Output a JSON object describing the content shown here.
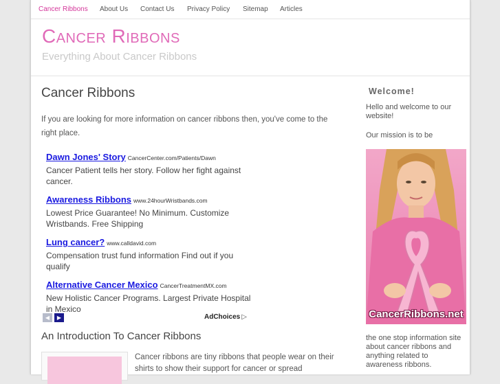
{
  "nav": {
    "items": [
      {
        "label": "Cancer Ribbons",
        "active": true
      },
      {
        "label": "About Us"
      },
      {
        "label": "Contact Us"
      },
      {
        "label": "Privacy Policy"
      },
      {
        "label": "Sitemap"
      },
      {
        "label": "Articles"
      }
    ]
  },
  "header": {
    "title": "Cancer Ribbons",
    "tagline": "Everything About Cancer Ribbons"
  },
  "main": {
    "heading": "Cancer Ribbons",
    "intro": "If you are looking for more information on cancer ribbons then, you've come to the right place.",
    "ads": [
      {
        "title": "Dawn Jones' Story",
        "url": "CancerCenter.com/Patients/Dawn",
        "desc": "Cancer Patient tells her story. Follow her fight against cancer."
      },
      {
        "title": "Awareness Ribbons",
        "url": "www.24hourWristbands.com",
        "desc": "Lowest Price Guarantee! No Minimum. Customize Wristbands. Free Shipping"
      },
      {
        "title": "Lung cancer?",
        "url": "www.calldavid.com",
        "desc": "Compensation trust fund information Find out if you qualify"
      },
      {
        "title": "Alternative Cancer Mexico",
        "url": "CancerTreatmentMX.com",
        "desc": "New Holistic Cancer Programs. Largest Private Hospital in Mexico"
      }
    ],
    "ad_prev": "◀",
    "ad_next": "▶",
    "adchoices": "AdChoices",
    "section_heading": "An Introduction To Cancer Ribbons",
    "body": "Cancer ribbons are tiny ribbons that people wear on their shirts to show their support for cancer or spread"
  },
  "sidebar": {
    "heading": "Welcome!",
    "p1": "Hello and welcome to our website!",
    "p2": "Our mission is to be",
    "image_caption": "CancerRibbons.net",
    "p3": "the one stop information site about cancer ribbons and anything related to awareness ribbons."
  },
  "colors": {
    "accent": "#e06ab8",
    "nav_active": "#d4369a",
    "ad_link": "#1a1ae0"
  }
}
